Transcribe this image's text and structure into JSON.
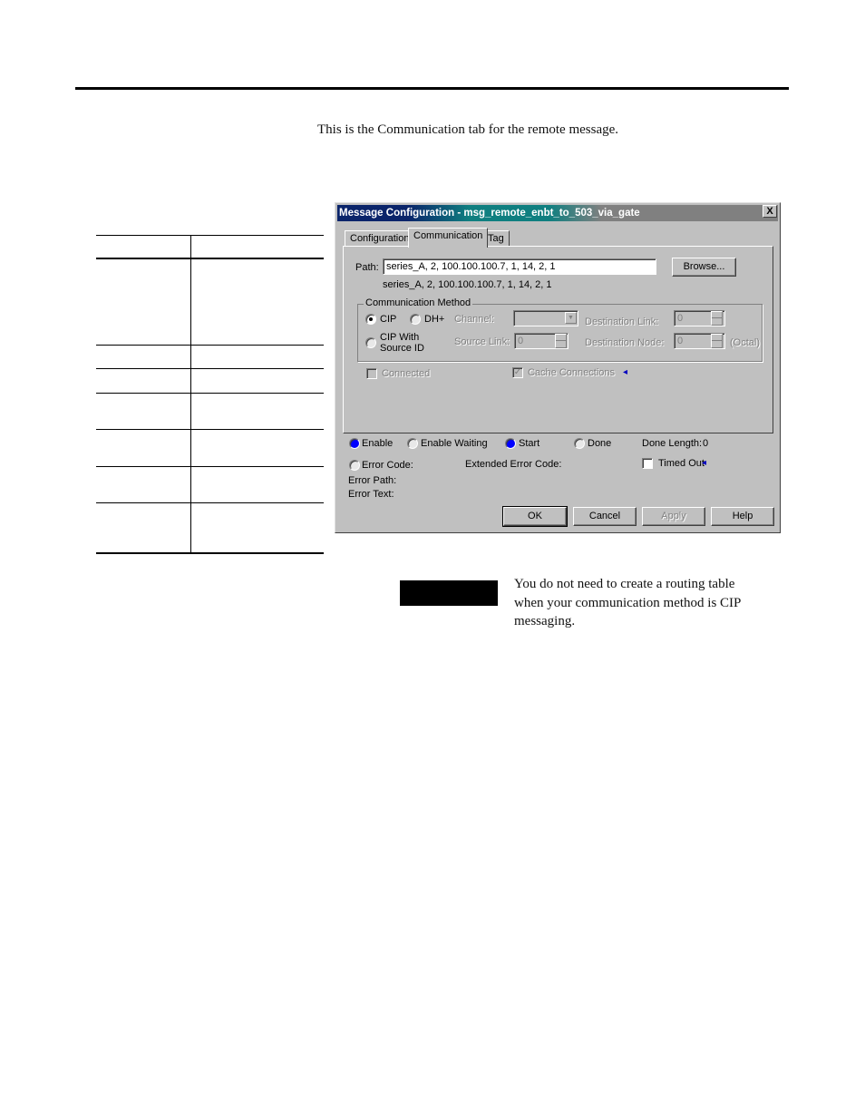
{
  "page": {
    "intro_text": "This is the Communication tab for the remote message.",
    "note_text": "You do not need to create a routing table when your communication method is CIP messaging."
  },
  "table": {
    "rows": 8
  },
  "dialog": {
    "title": "Message Configuration - msg_remote_enbt_to_503_via_gate",
    "close_label": "X",
    "tabs": [
      {
        "label": "Configuration",
        "active": false
      },
      {
        "label": "Communication",
        "active": true
      },
      {
        "label": "Tag",
        "active": false
      }
    ],
    "path_label": "Path:",
    "path_value": "series_A, 2, 100.100.100.7, 1, 14, 2, 1",
    "path_resolved": "series_A, 2, 100.100.100.7, 1, 14, 2, 1",
    "browse_label": "Browse...",
    "comm_method": {
      "title": "Communication Method",
      "cip_label": "CIP",
      "dhplus_label": "DH+",
      "cip_source_label_1": "CIP With",
      "cip_source_label_2": "Source ID",
      "selected": "CIP",
      "channel_label": "Channel:",
      "channel_value": "",
      "source_link_label": "Source Link:",
      "source_link_value": "0",
      "dest_link_label": "Destination Link:",
      "dest_link_value": "0",
      "dest_node_label": "Destination Node:",
      "dest_node_value": "0",
      "octal_label": "(Octal)"
    },
    "connected_label": "Connected",
    "connected_checked": false,
    "cache_label": "Cache Connections",
    "cache_checked": true,
    "status": {
      "enable_label": "Enable",
      "enable_waiting_label": "Enable Waiting",
      "start_label": "Start",
      "done_label": "Done",
      "done_length_label": "Done Length:",
      "done_length_value": "0",
      "error_code_label": "Error Code:",
      "extended_error_label": "Extended Error Code:",
      "timed_out_label": "Timed Out",
      "error_path_label": "Error Path:",
      "error_text_label": "Error Text:"
    },
    "buttons": {
      "ok": "OK",
      "cancel": "Cancel",
      "apply": "Apply",
      "help": "Help"
    }
  }
}
